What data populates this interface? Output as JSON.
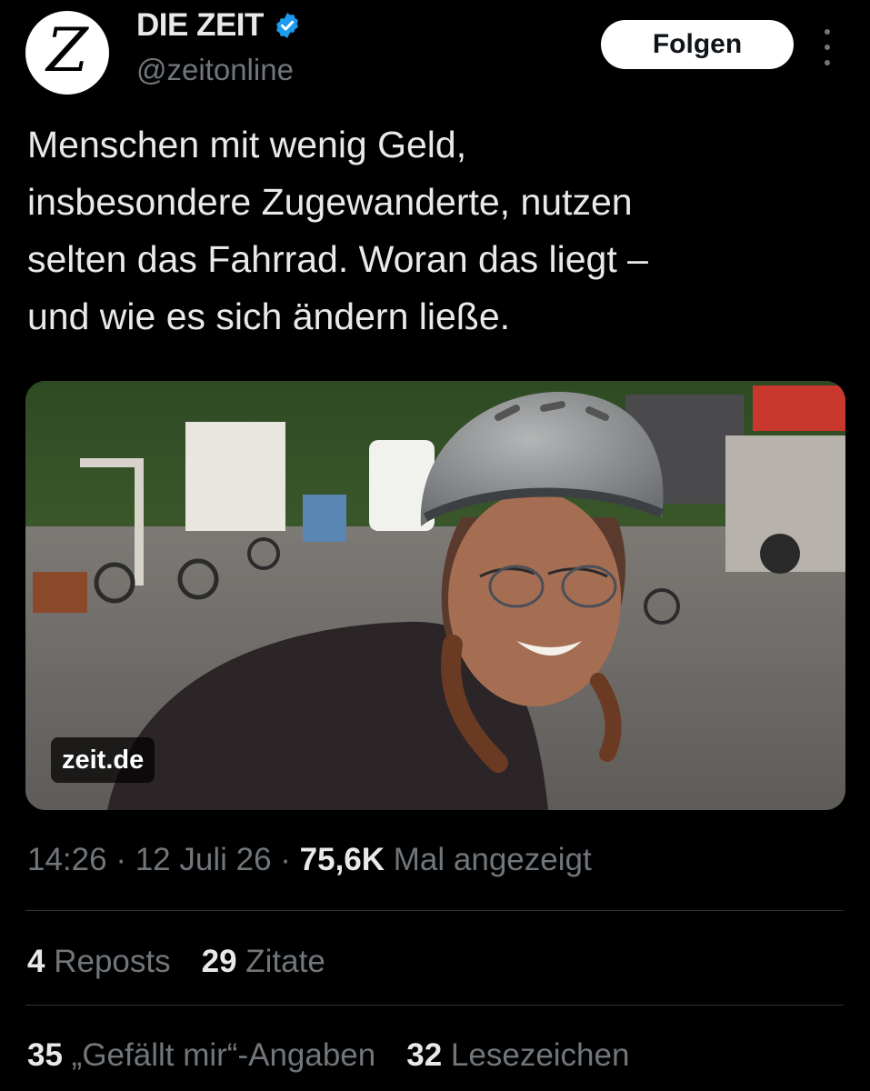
{
  "account": {
    "avatar_letter": "Z",
    "name": "DIE ZEIT",
    "handle": "@zeitonline",
    "verified_color": "#1d9bf0"
  },
  "actions": {
    "follow_label": "Folgen",
    "more_icon": "more-vertical-icon"
  },
  "tweet": {
    "text": "Menschen mit wenig Geld,\ninsbesondere Zugewanderte, nutzen\nselten das Fahrrad. Woran das liegt –\nund wie es sich ändern ließe.",
    "media_source": "zeit.de"
  },
  "meta": {
    "time": "14:26",
    "separator": " · ",
    "date": "12 Juli 26",
    "views_count": "75,6K",
    "views_label": "Mal angezeigt"
  },
  "stats": {
    "reposts_count": "4",
    "reposts_label": "Reposts",
    "quotes_count": "29",
    "quotes_label": "Zitate",
    "likes_count": "35",
    "likes_label": "„Gefällt mir“-Angaben",
    "bookmarks_count": "32",
    "bookmarks_label": "Lesezeichen"
  }
}
